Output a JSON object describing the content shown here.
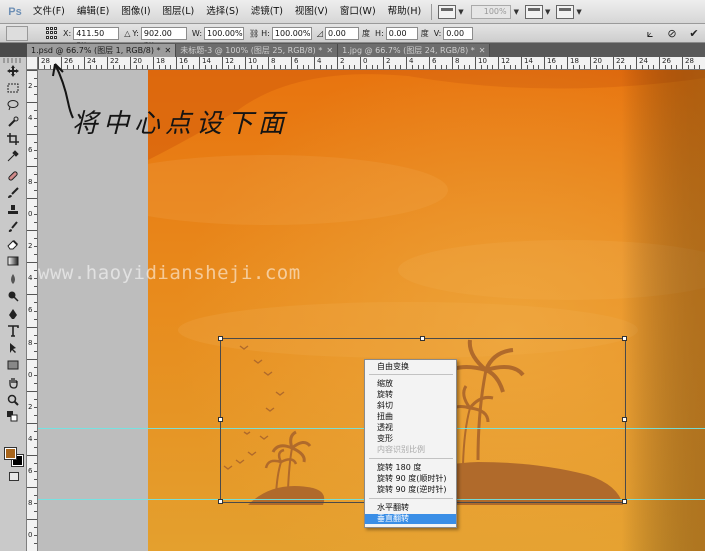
{
  "app": {
    "logo": "Ps"
  },
  "menubar": {
    "items": [
      "文件(F)",
      "编辑(E)",
      "图像(I)",
      "图层(L)",
      "选择(S)",
      "滤镜(T)",
      "视图(V)",
      "窗口(W)",
      "帮助(H)"
    ],
    "zoom_value": "100%"
  },
  "options": {
    "x_label": "X:",
    "x_value": "411.50 px",
    "y_label": "Y:",
    "y_value": "902.00 px",
    "w_label": "W:",
    "w_value": "100.00%",
    "h_label": "H:",
    "h_value": "100.00%",
    "angle_value": "0.00",
    "angle_unit": "度",
    "hskew_label": "H:",
    "hskew_value": "0.00",
    "hskew_unit": "度",
    "vskew_label": "V:",
    "vskew_value": "0.00"
  },
  "tabs": [
    {
      "label": "1.psd @ 66.7% (图层 1, RGB/8) *",
      "active": true
    },
    {
      "label": "未标题-3 @ 100% (图层 25, RGB/8) *",
      "active": false
    },
    {
      "label": "1.jpg @ 66.7% (图层 24, RGB/8) *",
      "active": false
    }
  ],
  "ruler": {
    "top_numbers": [
      "28",
      "26",
      "24",
      "22",
      "20",
      "18",
      "16",
      "14",
      "12",
      "10",
      "8",
      "6",
      "4",
      "2",
      "0",
      "2",
      "4",
      "6",
      "8",
      "10",
      "12",
      "14",
      "16",
      "18",
      "20",
      "22",
      "24",
      "26",
      "28"
    ],
    "left_numbers": [
      "2",
      "4",
      "6",
      "8",
      "0",
      "2",
      "4",
      "6",
      "8",
      "0",
      "2",
      "4",
      "6",
      "8",
      "0"
    ]
  },
  "annotation": "将中心点设下面",
  "watermark": "www.haoyidiansheji.com",
  "context_menu": {
    "items": [
      {
        "label": "自由变换",
        "state": "normal"
      },
      {
        "label": "缩放",
        "state": "normal"
      },
      {
        "label": "旋转",
        "state": "normal"
      },
      {
        "label": "斜切",
        "state": "normal"
      },
      {
        "label": "扭曲",
        "state": "normal"
      },
      {
        "label": "透视",
        "state": "normal"
      },
      {
        "label": "变形",
        "state": "normal"
      },
      {
        "label": "内容识别比例",
        "state": "disabled"
      },
      {
        "label": "旋转 180 度",
        "state": "normal"
      },
      {
        "label": "旋转 90 度(顺时针)",
        "state": "normal"
      },
      {
        "label": "旋转 90 度(逆时针)",
        "state": "normal"
      },
      {
        "label": "水平翻转",
        "state": "normal"
      },
      {
        "label": "垂直翻转",
        "state": "selected"
      }
    ]
  },
  "colors": {
    "foreground": "#a8651b",
    "background": "#000000",
    "canvas_sky_top": "#e8740f",
    "canvas_sky_bottom": "#e4a02e",
    "silhouette": "#b06a2b",
    "menu_highlight": "#3a8ee6",
    "guide": "#6fe6e6"
  }
}
